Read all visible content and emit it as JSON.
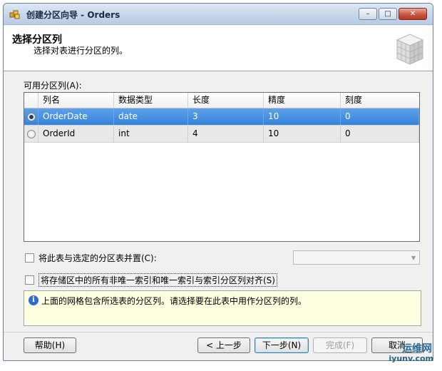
{
  "window": {
    "title": "创建分区向导 - Orders",
    "controls": {
      "minimize": "–",
      "maximize": "□",
      "close": "✕"
    }
  },
  "header": {
    "title": "选择分区列",
    "subtitle": "选择对表进行分区的列。"
  },
  "columns_section": {
    "label": "可用分区列(A):",
    "headers": [
      "列名",
      "数据类型",
      "长度",
      "精度",
      "刻度"
    ],
    "rows": [
      {
        "selected": true,
        "name": "OrderDate",
        "type": "date",
        "length": "3",
        "precision": "10",
        "scale": "0"
      },
      {
        "selected": false,
        "name": "OrderId",
        "type": "int",
        "length": "4",
        "precision": "10",
        "scale": "0"
      }
    ]
  },
  "options": {
    "collocate_label": "将此表与选定的分区表并置(C):",
    "collocate_checked": false,
    "collocate_combo_value": "",
    "align_indexes_label": "将存储区中的所有非唯一索引和唯一索引与索引分区列对齐(S)",
    "align_indexes_checked": false
  },
  "info": {
    "text": "上面的网格包含所选表的分区列。请选择要在此表中用作分区列的列。"
  },
  "buttons": {
    "help": "帮助(H)",
    "back": "< 上一步",
    "next": "下一步(N)",
    "finish": "完成(F)",
    "cancel": "取消"
  },
  "watermark": {
    "top": "运维网",
    "bottom": "iyunv.com"
  },
  "colors": {
    "selection": "#3384dd",
    "info_background": "#ffffe1",
    "close_button": "#c8553e"
  }
}
